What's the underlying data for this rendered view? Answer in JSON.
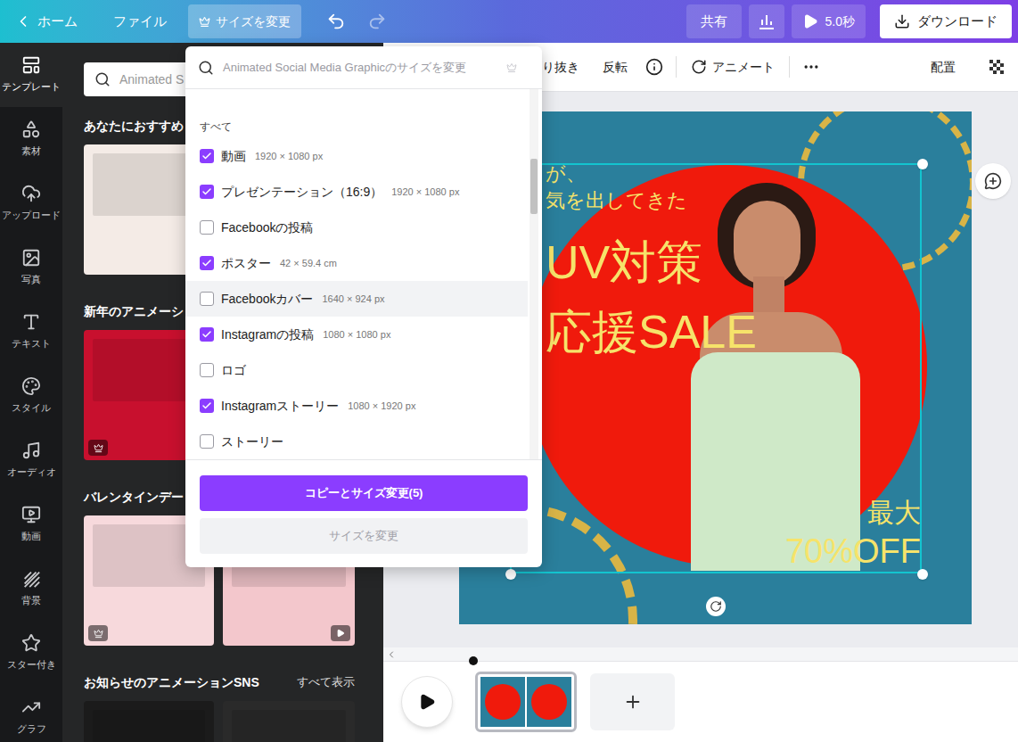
{
  "topbar": {
    "back": "ホーム",
    "file": "ファイル",
    "resize": "サイズを変更",
    "share": "共有",
    "duration": "5.0秒",
    "download": "ダウンロード"
  },
  "rail": [
    {
      "label": "テンプレート",
      "selected": true
    },
    {
      "label": "素材",
      "selected": false
    },
    {
      "label": "アップロード",
      "selected": false
    },
    {
      "label": "写真",
      "selected": false
    },
    {
      "label": "テキスト",
      "selected": false
    },
    {
      "label": "スタイル",
      "selected": false
    },
    {
      "label": "オーディオ",
      "selected": false
    },
    {
      "label": "動画",
      "selected": false
    },
    {
      "label": "背景",
      "selected": false
    },
    {
      "label": "スター付き",
      "selected": false
    },
    {
      "label": "グラフ",
      "selected": false
    }
  ],
  "panel": {
    "search_placeholder": "Animated S",
    "sections": [
      {
        "title": "あなたにおすすめ",
        "cards": [
          {
            "color": "#f4ebe6",
            "badge": "none"
          },
          {
            "color": "#f4ebe6",
            "badge": "none"
          }
        ]
      },
      {
        "title": "新年のアニメーシ",
        "cards": [
          {
            "color": "#c8102e",
            "badge": "premium"
          },
          {
            "color": "#d81e2c",
            "badge": "none"
          }
        ]
      },
      {
        "title": "バレンタインデー",
        "cards": [
          {
            "color": "#f7d9dc",
            "badge": "premium"
          },
          {
            "color": "#f3c7cc",
            "badge": "video"
          }
        ]
      },
      {
        "title": "お知らせのアニメーションSNS",
        "link": "すべて表示",
        "cards": [
          {
            "color": "#1b1b1b",
            "badge": "none"
          },
          {
            "color": "#2a2a2a",
            "badge": "none"
          }
        ]
      }
    ]
  },
  "toolbar": {
    "crop": "り抜き",
    "flip": "反転",
    "animate": "アニメート",
    "position": "配置"
  },
  "canvas": {
    "tagline": [
      "が、",
      "気を出してきた"
    ],
    "headline": [
      "UV対策",
      "応援SALE"
    ],
    "offer": [
      "最大",
      "70%OFF"
    ]
  },
  "resize_menu": {
    "placeholder": "Animated Social Media Graphicのサイズを変更",
    "group": "すべて",
    "items": [
      {
        "label": "動画",
        "size": "1920 × 1080 px",
        "checked": true,
        "hovered": false
      },
      {
        "label": "プレゼンテーション（16:9）",
        "size": "1920 × 1080 px",
        "checked": true,
        "hovered": false
      },
      {
        "label": "Facebookの投稿",
        "checked": false,
        "hovered": false
      },
      {
        "label": "ポスター",
        "size": "42 × 59.4 cm",
        "checked": true,
        "hovered": false
      },
      {
        "label": "Facebookカバー",
        "size": "1640 × 924 px",
        "checked": false,
        "hovered": true
      },
      {
        "label": "Instagramの投稿",
        "size": "1080 × 1080 px",
        "checked": true,
        "hovered": false
      },
      {
        "label": "ロゴ",
        "checked": false,
        "hovered": false
      },
      {
        "label": "Instagramストーリー",
        "size": "1080 × 1920 px",
        "checked": true,
        "hovered": false
      },
      {
        "label": "ストーリー",
        "checked": false,
        "hovered": false
      }
    ],
    "primary": "コピーとサイズ変更(5)",
    "secondary": "サイズを変更",
    "secondary_disabled": true
  }
}
